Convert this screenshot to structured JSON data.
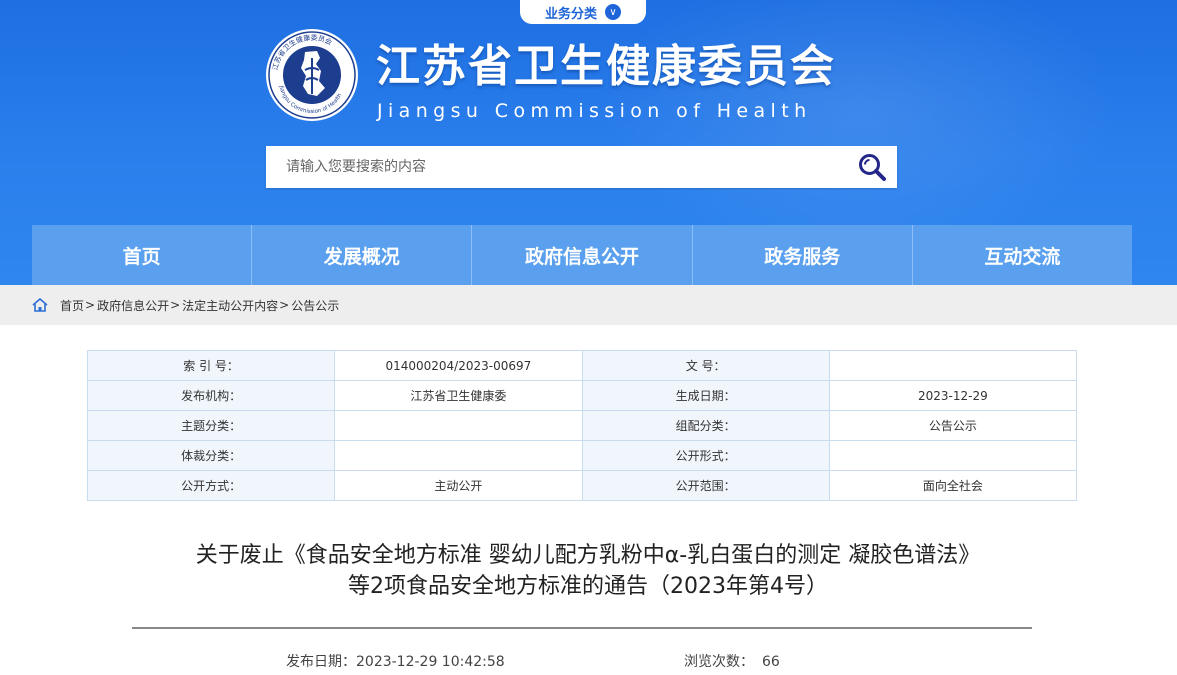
{
  "header": {
    "biz_tab_label": "业务分类",
    "site_title": "江苏省卫生健康委员会",
    "site_subtitle": "Jiangsu Commission of Health",
    "logo_text": "江苏省卫生健康委员会 Jiangsu Commission of Health",
    "colors": {
      "header_bg": "#2b7fec",
      "nav_bg": "#5aa0ee",
      "accent": "#1f64d8"
    }
  },
  "search": {
    "placeholder": "请输入您要搜索的内容",
    "icon": "search-icon"
  },
  "nav": {
    "items": [
      "首页",
      "发展概况",
      "政府信息公开",
      "政务服务",
      "互动交流"
    ]
  },
  "breadcrumb": {
    "icon": "home-icon",
    "items": [
      "首页",
      "政府信息公开",
      "法定主动公开内容",
      "公告公示"
    ],
    "separator": ">"
  },
  "meta": {
    "rows": [
      {
        "l1": "索 引 号：",
        "v1": "014000204/2023-00697",
        "l2": "文      号：",
        "v2": ""
      },
      {
        "l1": "发布机构：",
        "v1": "江苏省卫生健康委",
        "l2": "生成日期：",
        "v2": "2023-12-29"
      },
      {
        "l1": "主题分类：",
        "v1": "",
        "l2": "组配分类：",
        "v2": "公告公示"
      },
      {
        "l1": "体裁分类：",
        "v1": "",
        "l2": "公开形式：",
        "v2": ""
      },
      {
        "l1": "公开方式：",
        "v1": "主动公开",
        "l2": "公开范围：",
        "v2": "面向全社会"
      }
    ]
  },
  "article": {
    "title_line1": "关于废止《食品安全地方标准 婴幼儿配方乳粉中α-乳白蛋白的测定 凝胶色谱法》",
    "title_line2": "等2项食品安全地方标准的通告（2023年第4号）",
    "publish_label": "发布日期：",
    "publish_date": "2023-12-29 10:42:58",
    "views_label": "浏览次数：",
    "views": "66"
  }
}
